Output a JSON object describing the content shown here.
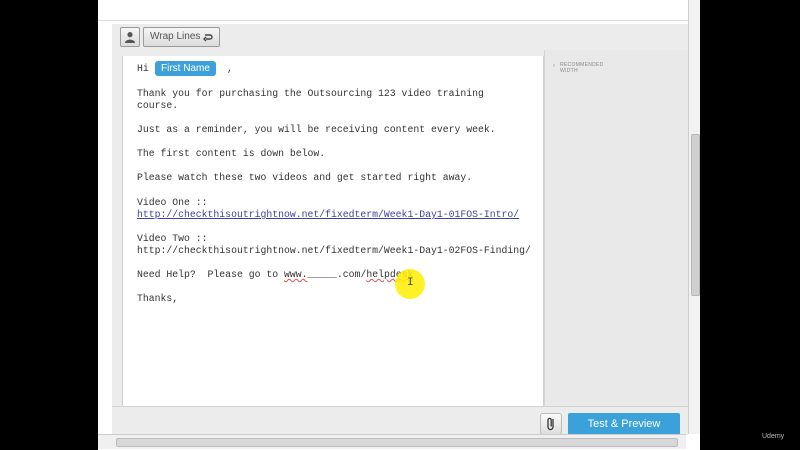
{
  "toolbar": {
    "wrap_label": "Wrap Lines"
  },
  "sidebar": {
    "recommended_width": "RECOMMENDED WIDTH"
  },
  "editor": {
    "token_name": "First Name",
    "greeting_prefix": "Hi",
    "greeting_suffix": ",",
    "line1a": "Thank you for purchasing the Outsourcing 123 video training",
    "line1b": "course.",
    "line2": "Just as a reminder, you will be receiving content every week.",
    "line3": "The first content is down below.",
    "line4": "Please watch these two videos and get started right away.",
    "video1_label": "Video One ::",
    "video1_url": "http://checkthisoutrightnow.net/fixedterm/Week1-Day1-01FOS-Intro/",
    "video2_label": "Video Two ::",
    "video2_url": "http://checkthisoutrightnow.net/fixedterm/Week1-Day1-02FOS-Finding/",
    "help_prefix": "Need Help?  Please go to ",
    "help_url_a": "www.",
    "help_url_b": "_____",
    "help_url_c": ".com/",
    "help_url_d": "helpdesk",
    "closing": "Thanks,"
  },
  "footer": {
    "test_preview_label": "Test & Preview"
  },
  "watermark": "Udemy"
}
